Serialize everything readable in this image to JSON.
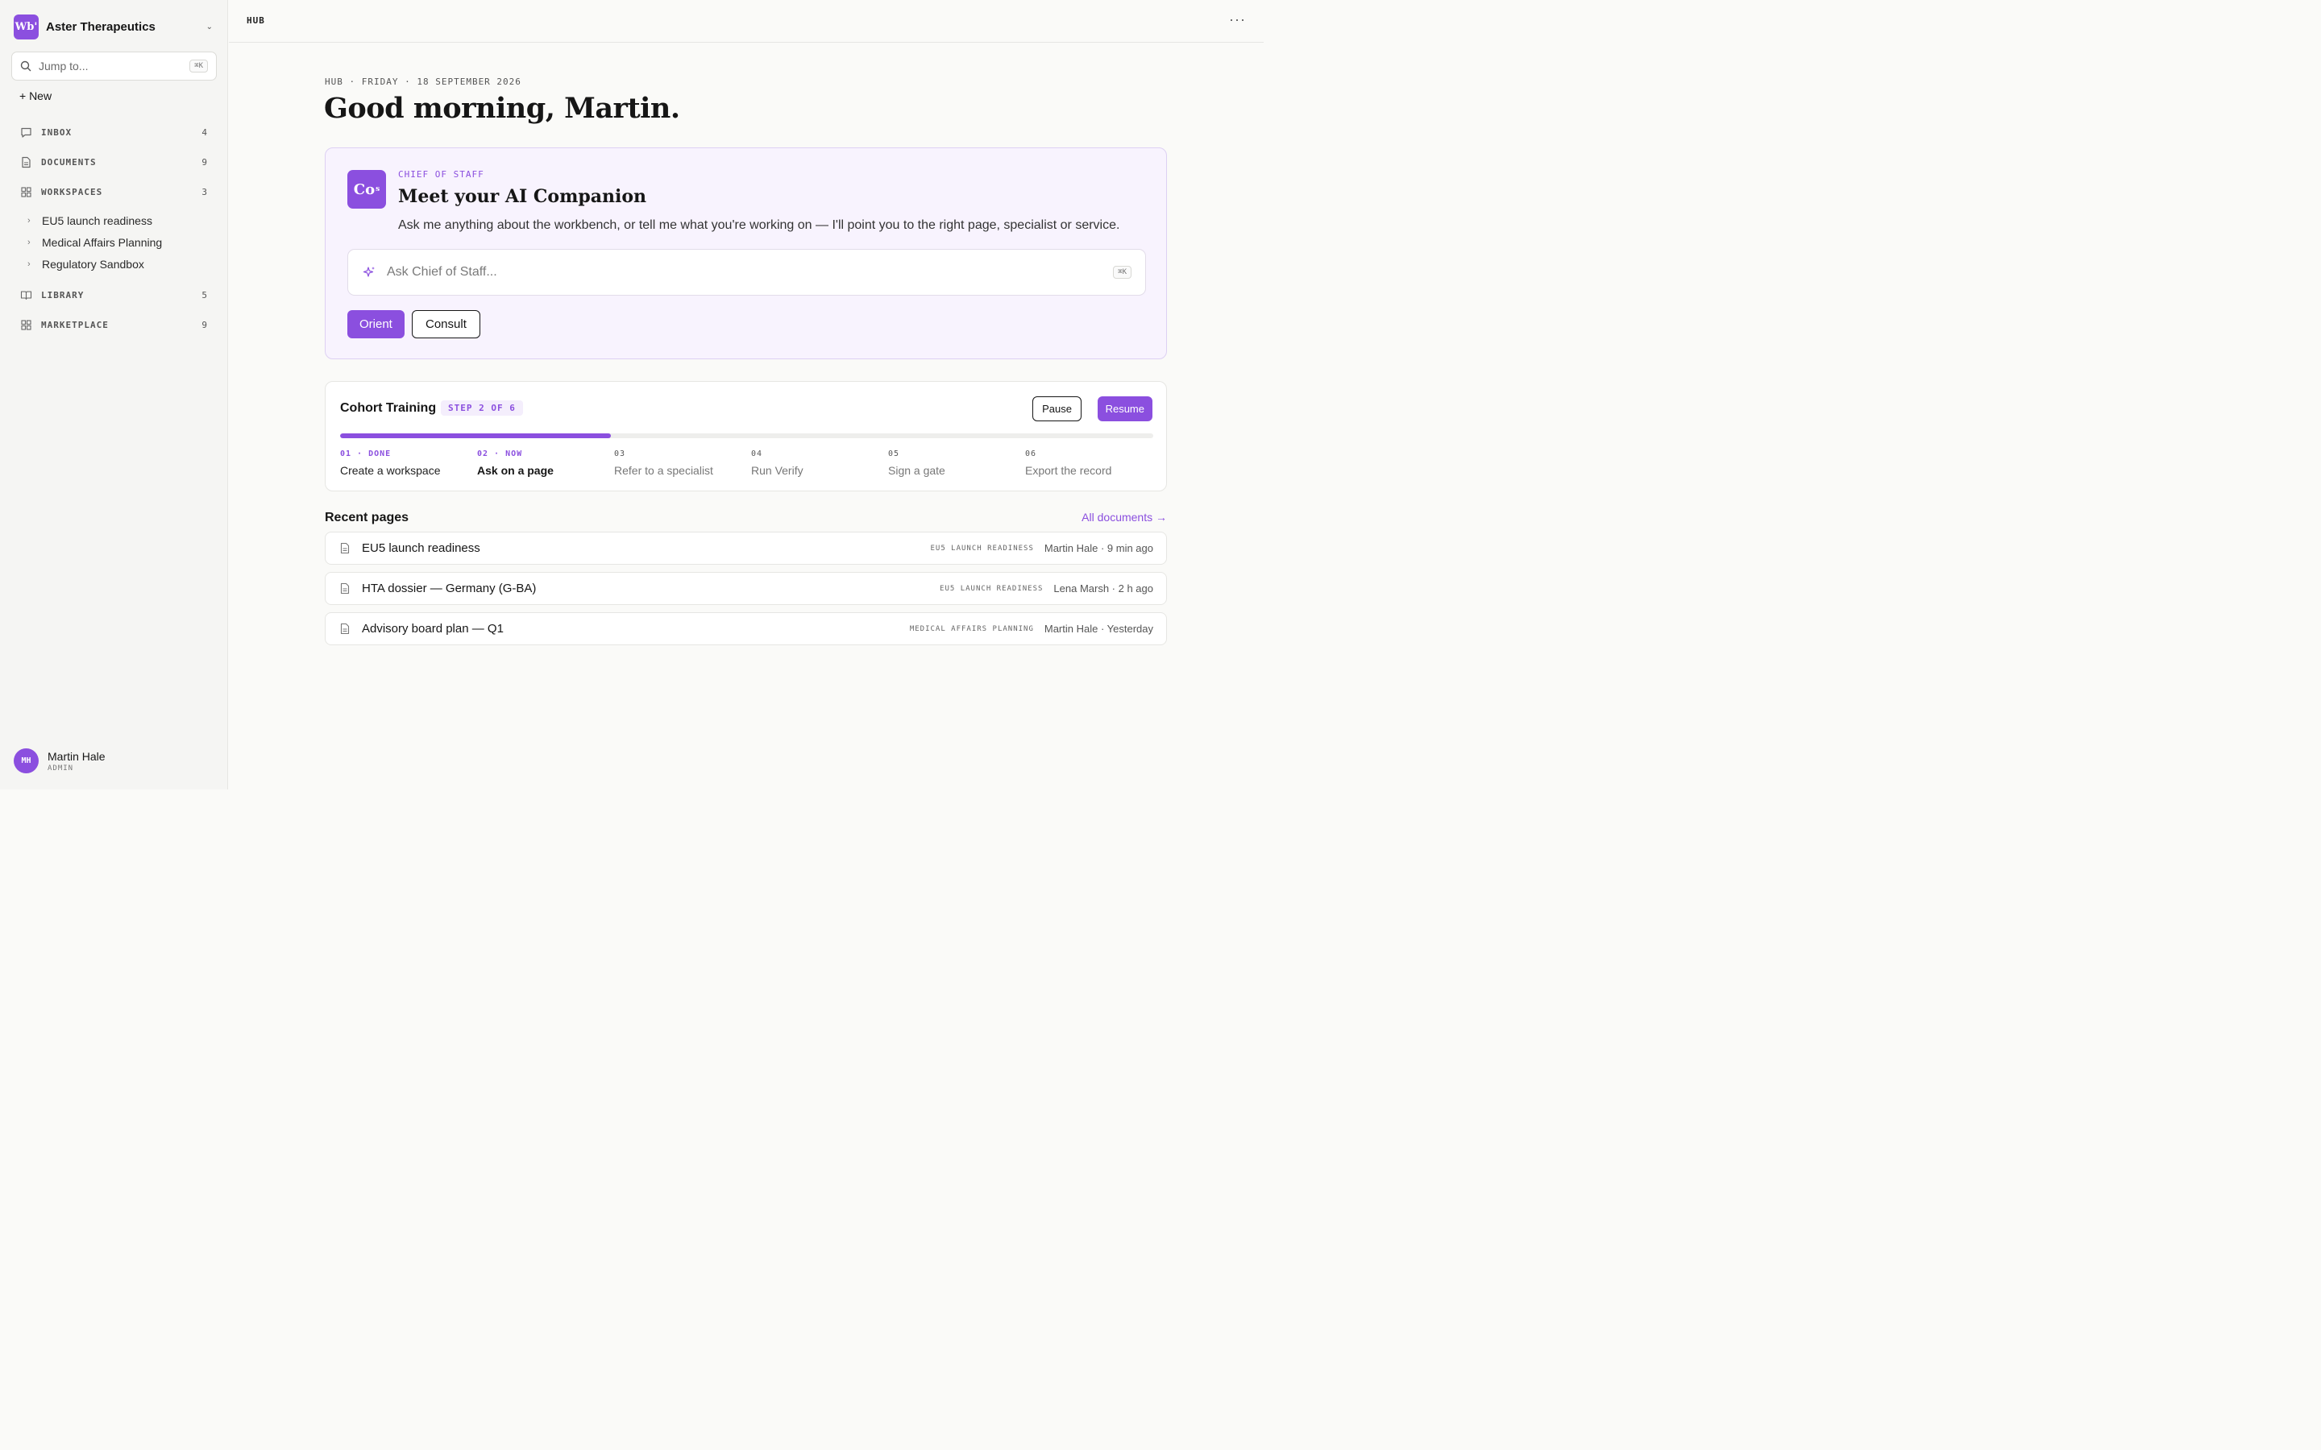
{
  "sidebar": {
    "org": {
      "logo_text": "Wb'",
      "name": "Aster Therapeutics"
    },
    "jump": {
      "placeholder": "Jump to...",
      "shortcut": "⌘K"
    },
    "new_label": "+ New",
    "nav": [
      {
        "label": "INBOX",
        "count": "4",
        "icon": "chat-bubble-icon"
      },
      {
        "label": "DOCUMENTS",
        "count": "9",
        "icon": "document-icon"
      },
      {
        "label": "WORKSPACES",
        "count": "3",
        "icon": "grid-icon"
      },
      {
        "label": "LIBRARY",
        "count": "5",
        "icon": "book-icon"
      },
      {
        "label": "MARKETPLACE",
        "count": "9",
        "icon": "grid-icon"
      }
    ],
    "workspaces": [
      "EU5 launch readiness",
      "Medical Affairs Planning",
      "Regulatory Sandbox"
    ],
    "user": {
      "initials": "MH",
      "name": "Martin Hale",
      "role": "ADMIN"
    }
  },
  "topbar": {
    "breadcrumb": "HUB",
    "more": "···"
  },
  "main": {
    "date_line": "HUB · FRIDAY · 18 SEPTEMBER 2026",
    "greeting": "Good morning, Martin.",
    "cos": {
      "logo_text": "Co",
      "logo_sub": "s",
      "kicker": "CHIEF OF STAFF",
      "title": "Meet your AI Companion",
      "description": "Ask me anything about the workbench, or tell me what you're working on — I'll point you to the right page, specialist or service.",
      "ask_placeholder": "Ask Chief of Staff...",
      "ask_shortcut": "⌘K",
      "orient_label": "Orient",
      "consult_label": "Consult"
    },
    "training": {
      "title": "Cohort Training",
      "step_badge": "STEP 2 OF 6",
      "pause_label": "Pause",
      "resume_label": "Resume",
      "progress_fraction": 0.333,
      "steps": [
        {
          "num": "01 · DONE",
          "label": "Create a workspace",
          "state": "done"
        },
        {
          "num": "02 · NOW",
          "label": "Ask on a page",
          "state": "now"
        },
        {
          "num": "03",
          "label": "Refer to a specialist",
          "state": "todo"
        },
        {
          "num": "04",
          "label": "Run Verify",
          "state": "todo"
        },
        {
          "num": "05",
          "label": "Sign a gate",
          "state": "todo"
        },
        {
          "num": "06",
          "label": "Export the record",
          "state": "todo"
        }
      ]
    },
    "recent": {
      "title": "Recent pages",
      "all_link": "All documents →",
      "rows": [
        {
          "title": "EU5 launch readiness",
          "workspace": "EU5 LAUNCH READINESS",
          "meta": "Martin Hale · 9 min ago"
        },
        {
          "title": "HTA dossier — Germany (G-BA)",
          "workspace": "EU5 LAUNCH READINESS",
          "meta": "Lena Marsh · 2 h ago"
        },
        {
          "title": "Advisory board plan — Q1",
          "workspace": "MEDICAL AFFAIRS PLANNING",
          "meta": "Martin Hale · Yesterday"
        }
      ]
    }
  },
  "colors": {
    "accent": "#8b4fdf",
    "accent_soft": "#f8f3fe",
    "text": "#161616"
  }
}
